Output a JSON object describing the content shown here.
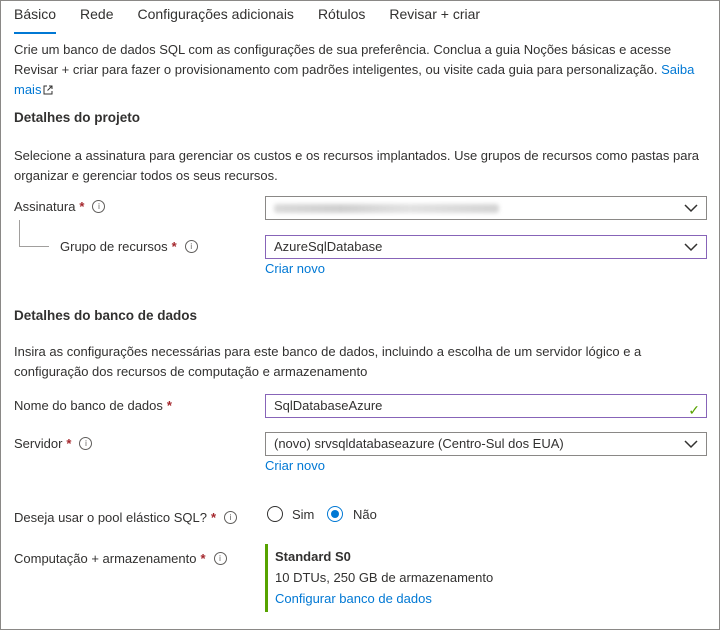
{
  "tabs": [
    {
      "label": "Básico"
    },
    {
      "label": "Rede"
    },
    {
      "label": "Configurações adicionais"
    },
    {
      "label": "Rótulos"
    },
    {
      "label": "Revisar + criar"
    }
  ],
  "intro": {
    "text": "Crie um banco de dados SQL com as configurações de sua preferência. Conclua a guia Noções básicas e acesse Revisar + criar para fazer o provisionamento com padrões inteligentes, ou visite cada guia para personalização.",
    "link": "Saiba mais"
  },
  "project": {
    "title": "Detalhes do projeto",
    "description": "Selecione a assinatura para gerenciar os custos e os recursos implantados. Use grupos de recursos como pastas para organizar e gerenciar todos os seus recursos.",
    "subscription_label": "Assinatura",
    "resource_group_label": "Grupo de recursos",
    "resource_group_value": "AzureSqlDatabase",
    "create_new": "Criar novo"
  },
  "database": {
    "title": "Detalhes do banco de dados",
    "description": "Insira as configurações necessárias para este banco de dados, incluindo a escolha de um servidor lógico e a configuração dos recursos de computação e armazenamento",
    "name_label": "Nome do banco de dados",
    "name_value": "SqlDatabaseAzure",
    "server_label": "Servidor",
    "server_value": "(novo) srvsqldatabaseazure (Centro-Sul dos EUA)",
    "server_create_new": "Criar novo",
    "elastic_pool_label": "Deseja usar o pool elástico SQL?",
    "elastic_pool_options": [
      "Sim",
      "Não"
    ],
    "elastic_pool_selected": "Não",
    "compute_label": "Computação + armazenamento",
    "tier_name": "Standard S0",
    "tier_description": "10 DTUs, 250 GB de armazenamento",
    "configure_link": "Configurar banco de dados"
  },
  "colors": {
    "accent": "#0078d4",
    "required": "#a4262c",
    "focus_border": "#8764b8",
    "valid": "#57a300"
  },
  "required_marker": "*"
}
